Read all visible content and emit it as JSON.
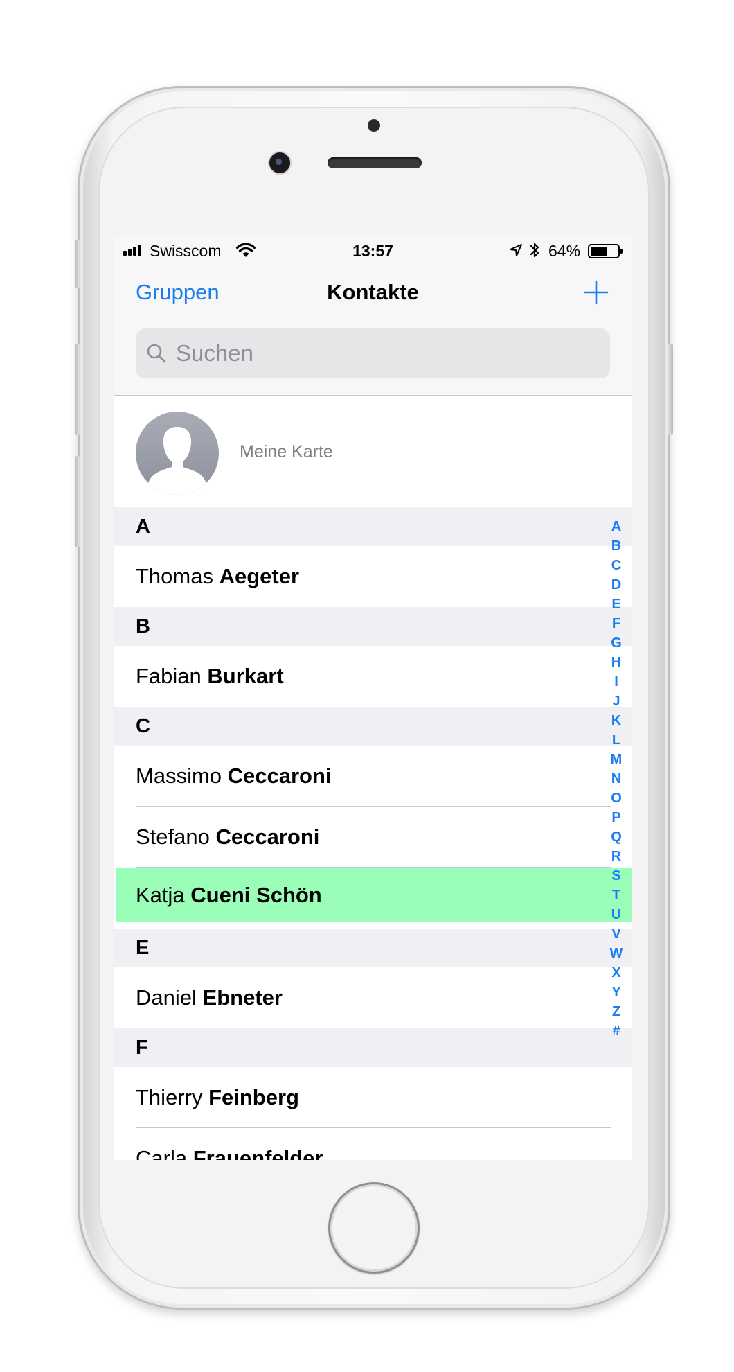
{
  "status_bar": {
    "carrier": "Swisscom",
    "time": "13:57",
    "battery_percent": "64%",
    "battery_level": 0.64
  },
  "nav": {
    "left_label": "Gruppen",
    "title": "Kontakte",
    "add_icon": "plus-icon"
  },
  "search": {
    "placeholder": "Suchen",
    "icon": "search-icon"
  },
  "my_card": {
    "label": "Meine Karte"
  },
  "sections": [
    {
      "letter": "A",
      "contacts": [
        {
          "first": "Thomas",
          "last": "Aegeter"
        }
      ]
    },
    {
      "letter": "B",
      "contacts": [
        {
          "first": "Fabian",
          "last": "Burkart"
        }
      ]
    },
    {
      "letter": "C",
      "contacts": [
        {
          "first": "Massimo",
          "last": "Ceccaroni"
        },
        {
          "first": "Stefano",
          "last": "Ceccaroni"
        },
        {
          "first": "Katja",
          "last": "Cueni Schön",
          "highlighted": true
        }
      ]
    },
    {
      "letter": "E",
      "contacts": [
        {
          "first": "Daniel",
          "last": "Ebneter"
        }
      ]
    },
    {
      "letter": "F",
      "contacts": [
        {
          "first": "Thierry",
          "last": "Feinberg"
        },
        {
          "first": "Carla",
          "last": "Frauenfelder"
        }
      ]
    }
  ],
  "index_letters": [
    "A",
    "B",
    "C",
    "D",
    "E",
    "F",
    "G",
    "H",
    "I",
    "J",
    "K",
    "L",
    "M",
    "N",
    "O",
    "P",
    "Q",
    "R",
    "S",
    "T",
    "U",
    "V",
    "W",
    "X",
    "Y",
    "Z",
    "#"
  ],
  "colors": {
    "accent": "#1a7ef2",
    "highlight": "#9afdb8",
    "section_bg": "#efeff4"
  }
}
